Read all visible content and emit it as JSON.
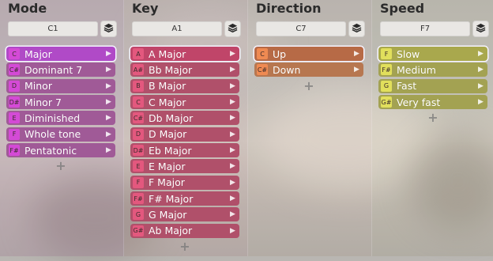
{
  "columns": [
    {
      "key": "mode",
      "title": "Mode",
      "header_value": "C1",
      "items": [
        {
          "note": "C",
          "label": "Major",
          "selected": true
        },
        {
          "note": "C#",
          "label": "Dominant 7"
        },
        {
          "note": "D",
          "label": "Minor"
        },
        {
          "note": "D#",
          "label": "Minor 7"
        },
        {
          "note": "E",
          "label": "Diminished"
        },
        {
          "note": "F",
          "label": "Whole tone"
        },
        {
          "note": "F#",
          "label": "Pentatonic"
        }
      ],
      "colors": {
        "item": "#a05a97",
        "selected": "#b04ac7",
        "note": "#d44ad6",
        "bg": "rgba(170,70,160,0.10)"
      }
    },
    {
      "key": "key",
      "title": "Key",
      "header_value": "A1",
      "items": [
        {
          "note": "A",
          "label": "A Major",
          "selected": true
        },
        {
          "note": "A#",
          "label": "Bb Major"
        },
        {
          "note": "B",
          "label": "B Major"
        },
        {
          "note": "C",
          "label": "C Major"
        },
        {
          "note": "C#",
          "label": "Db Major"
        },
        {
          "note": "D",
          "label": "D Major"
        },
        {
          "note": "D#",
          "label": "Eb Major"
        },
        {
          "note": "E",
          "label": "E Major"
        },
        {
          "note": "F",
          "label": "F Major"
        },
        {
          "note": "F#",
          "label": "F# Major"
        },
        {
          "note": "G",
          "label": "G Major"
        },
        {
          "note": "G#",
          "label": "Ab Major"
        }
      ],
      "colors": {
        "item": "#b0506a",
        "selected": "#c04569",
        "note": "#e3587e",
        "bg": "rgba(200,80,100,0.06)"
      }
    },
    {
      "key": "direction",
      "title": "Direction",
      "header_value": "C7",
      "items": [
        {
          "note": "C",
          "label": "Up",
          "selected": true
        },
        {
          "note": "C#",
          "label": "Down"
        }
      ],
      "colors": {
        "item": "#b77750",
        "selected": "#b76a46",
        "note": "#ef8a52",
        "bg": "rgba(200,120,80,0.04)"
      }
    },
    {
      "key": "speed",
      "title": "Speed",
      "header_value": "F7",
      "items": [
        {
          "note": "F",
          "label": "Slow",
          "selected": true
        },
        {
          "note": "F#",
          "label": "Medium"
        },
        {
          "note": "G",
          "label": "Fast"
        },
        {
          "note": "G#",
          "label": "Very fast"
        }
      ],
      "colors": {
        "item": "#a3a252",
        "selected": "#a9a84d",
        "note": "#e1df5c",
        "bg": "rgba(170,170,80,0.06)"
      }
    }
  ],
  "add_symbol": "+",
  "chevron": "▶"
}
